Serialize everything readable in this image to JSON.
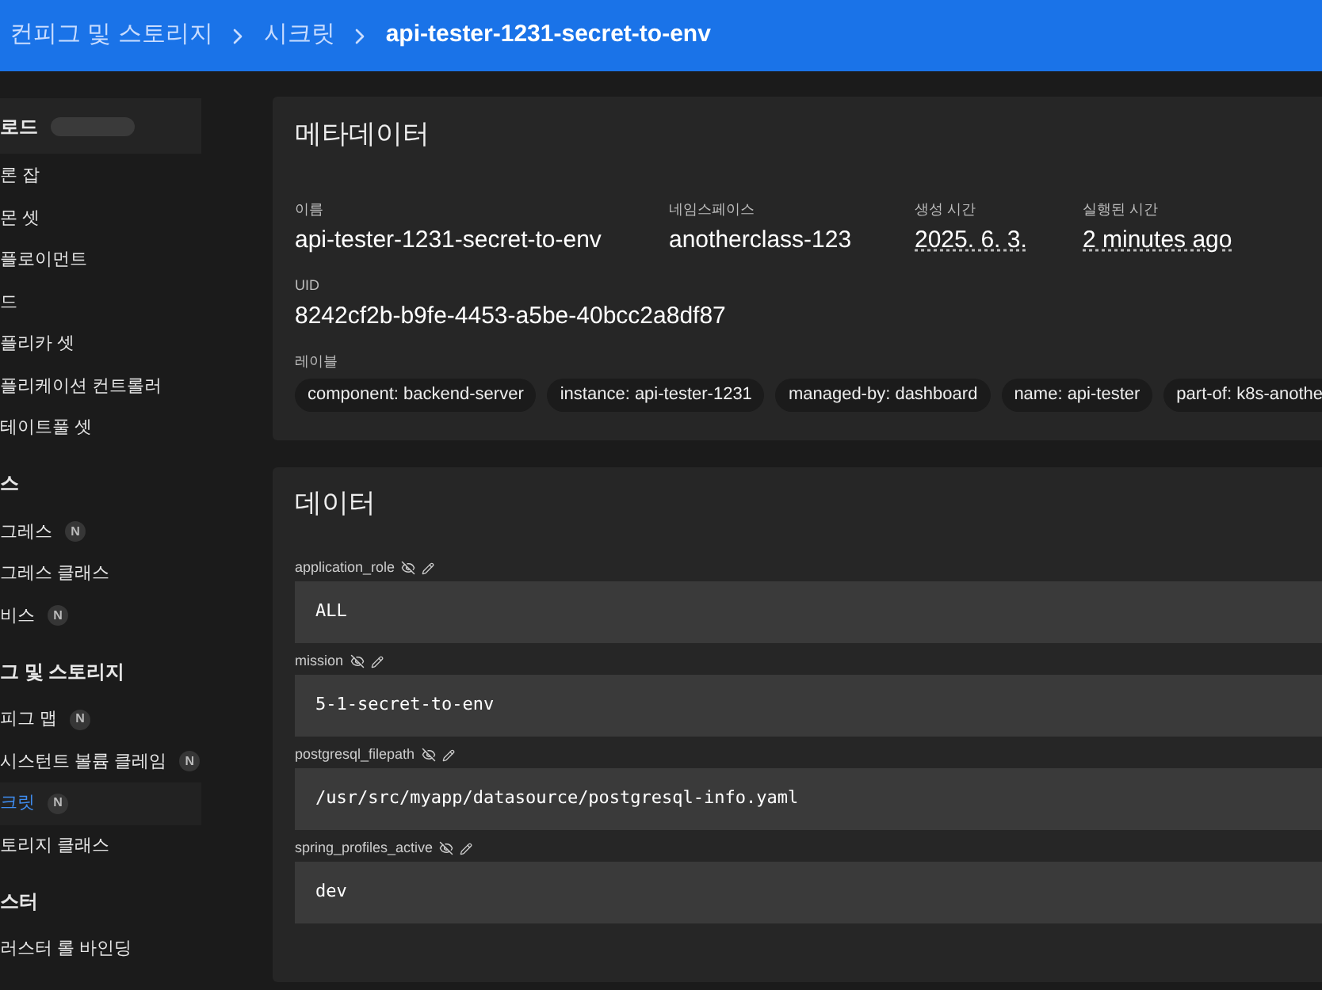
{
  "breadcrumb": [
    {
      "label": "컨피그 및 스토리지"
    },
    {
      "label": "시크릿"
    },
    {
      "label": "api-tester-1231-secret-to-env"
    }
  ],
  "sidebar": {
    "items": [
      {
        "kind": "header",
        "label": "로드"
      },
      {
        "kind": "item",
        "label": "론 잡",
        "selected": false
      },
      {
        "kind": "item",
        "label": "몬 셋",
        "selected": false
      },
      {
        "kind": "item",
        "label": "플로이먼트",
        "selected": false
      },
      {
        "kind": "item",
        "label": "드",
        "selected": false
      },
      {
        "kind": "item",
        "label": "플리카 셋",
        "selected": false
      },
      {
        "kind": "item",
        "label": "플리케이션 컨트롤러",
        "selected": false
      },
      {
        "kind": "item",
        "label": "테이트풀 셋",
        "selected": false
      },
      {
        "kind": "header",
        "label": "스"
      },
      {
        "kind": "item",
        "label": "그레스",
        "badge": "N",
        "selected": false
      },
      {
        "kind": "item",
        "label": "그레스 클래스",
        "selected": false
      },
      {
        "kind": "item",
        "label": "비스",
        "badge": "N",
        "selected": false
      },
      {
        "kind": "header",
        "label": "그 및 스토리지"
      },
      {
        "kind": "item",
        "label": "피그 맵",
        "badge": "N",
        "selected": false
      },
      {
        "kind": "item",
        "label": "시스턴트 볼륨 클레임",
        "badge": "N",
        "selected": false
      },
      {
        "kind": "item",
        "label": "크릿",
        "badge": "N",
        "selected": true
      },
      {
        "kind": "item",
        "label": "토리지 클래스",
        "selected": false
      },
      {
        "kind": "header",
        "label": "스터"
      },
      {
        "kind": "item",
        "label": "러스터 롤 바인딩",
        "selected": false
      }
    ]
  },
  "metadata": {
    "title": "메타데이터",
    "fields": [
      {
        "label": "이름",
        "value": "api-tester-1231-secret-to-env",
        "dotted": false
      },
      {
        "label": "네임스페이스",
        "value": "anotherclass-123",
        "dotted": false
      },
      {
        "label": "생성 시간",
        "value": "2025. 6. 3.",
        "dotted": true
      },
      {
        "label": "실행된 시간",
        "value": "2 minutes ago",
        "dotted": true
      }
    ],
    "uid": {
      "label": "UID",
      "value": "8242cf2b-b9fe-4453-a5be-40bcc2a8df87"
    },
    "labels_title": "레이블",
    "labels": [
      "component: backend-server",
      "instance: api-tester-1231",
      "managed-by: dashboard",
      "name: api-tester",
      "part-of: k8s-anothe"
    ]
  },
  "data": {
    "title": "데이터",
    "entries": [
      {
        "key": "application_role",
        "value": "ALL"
      },
      {
        "key": "mission",
        "value": "5-1-secret-to-env"
      },
      {
        "key": "postgresql_filepath",
        "value": "/usr/src/myapp/datasource/postgresql-info.yaml"
      },
      {
        "key": "spring_profiles_active",
        "value": "dev"
      }
    ]
  }
}
